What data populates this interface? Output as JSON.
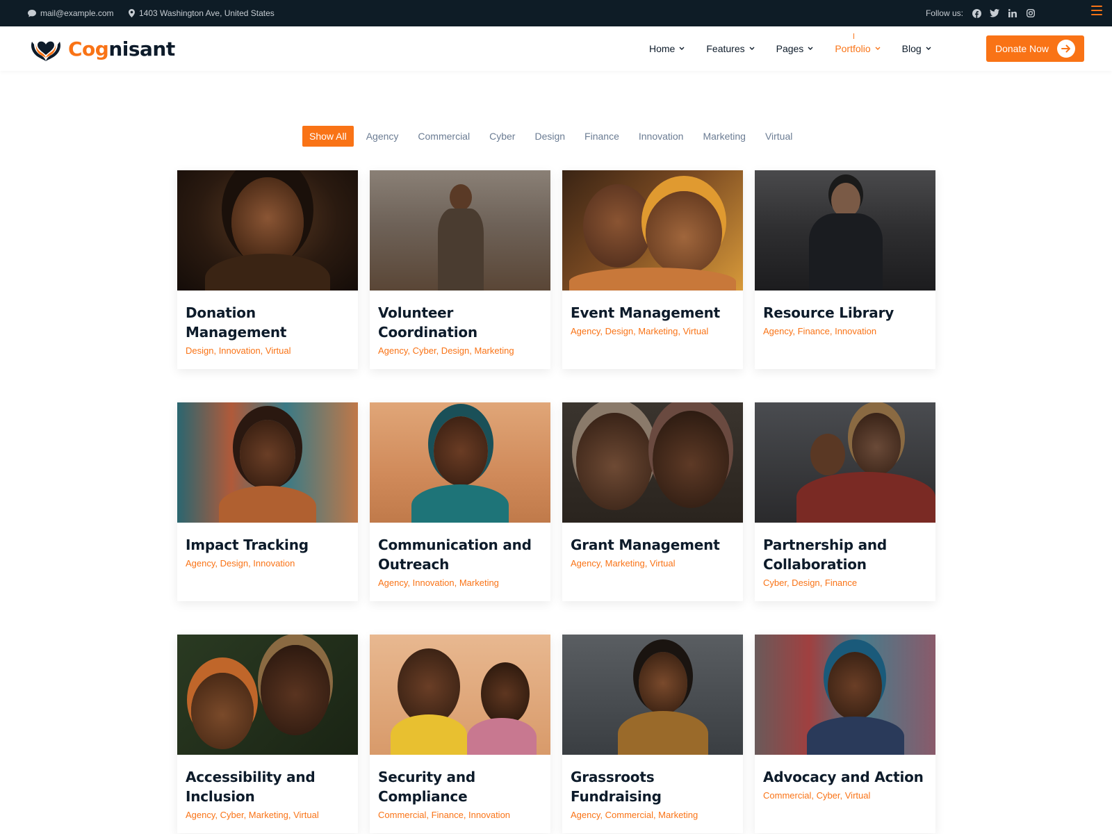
{
  "topbar": {
    "email": "mail@example.com",
    "address": "1403 Washington Ave, United States",
    "follow_label": "Follow us:",
    "socials": [
      "facebook-icon",
      "twitter-icon",
      "linkedin-icon",
      "instagram-icon"
    ]
  },
  "header": {
    "logo_part1": "Cog",
    "logo_part2": "nisant",
    "nav": [
      "Home",
      "Features",
      "Pages",
      "Portfolio",
      "Blog"
    ],
    "active_nav": "Portfolio",
    "donate_label": "Donate Now"
  },
  "filters": [
    "Show All",
    "Agency",
    "Commercial",
    "Cyber",
    "Design",
    "Finance",
    "Innovation",
    "Marketing",
    "Virtual"
  ],
  "active_filter": "Show All",
  "colors": {
    "accent": "#f97316",
    "dark": "#0e1c26",
    "text": "#0d1b2a",
    "muted": "#6b7c93"
  },
  "portfolio": [
    {
      "title": "Donation Management",
      "categories": "Design, Innovation, Virtual"
    },
    {
      "title": "Volunteer Coordination",
      "categories": "Agency, Cyber, Design, Marketing"
    },
    {
      "title": "Event Management",
      "categories": "Agency, Design, Marketing, Virtual"
    },
    {
      "title": "Resource Library",
      "categories": "Agency, Finance, Innovation"
    },
    {
      "title": "Impact Tracking",
      "categories": "Agency, Design, Innovation"
    },
    {
      "title": "Communication and Outreach",
      "categories": "Agency, Innovation, Marketing"
    },
    {
      "title": "Grant Management",
      "categories": "Agency, Marketing, Virtual"
    },
    {
      "title": "Partnership and Collaboration",
      "categories": "Cyber, Design, Finance"
    },
    {
      "title": "Accessibility and Inclusion",
      "categories": "Agency, Cyber, Marketing, Virtual"
    },
    {
      "title": "Security and Compliance",
      "categories": "Commercial, Finance, Innovation"
    },
    {
      "title": "Grassroots Fundraising",
      "categories": "Agency, Commercial, Marketing"
    },
    {
      "title": "Advocacy and Action",
      "categories": "Commercial, Cyber, Virtual"
    }
  ]
}
